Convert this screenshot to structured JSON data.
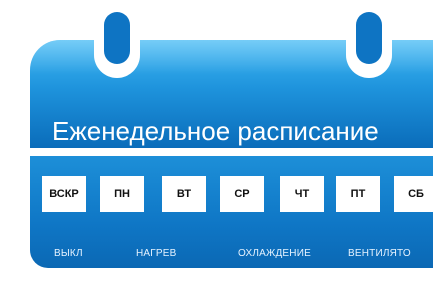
{
  "header": {
    "title": "Еженедельное расписание"
  },
  "days": [
    "ВСКР",
    "ПН",
    "ВТ",
    "СР",
    "ЧТ",
    "ПТ",
    "СБ"
  ],
  "modes": [
    "ВЫКЛ",
    "НАГРЕВ",
    "ОХЛАЖДЕНИЕ",
    "ВЕНТИЛЯТО"
  ],
  "colors": {
    "accent": "#1a8ad6",
    "accent_dark": "#0b68b4",
    "tile": "#ffffff"
  }
}
